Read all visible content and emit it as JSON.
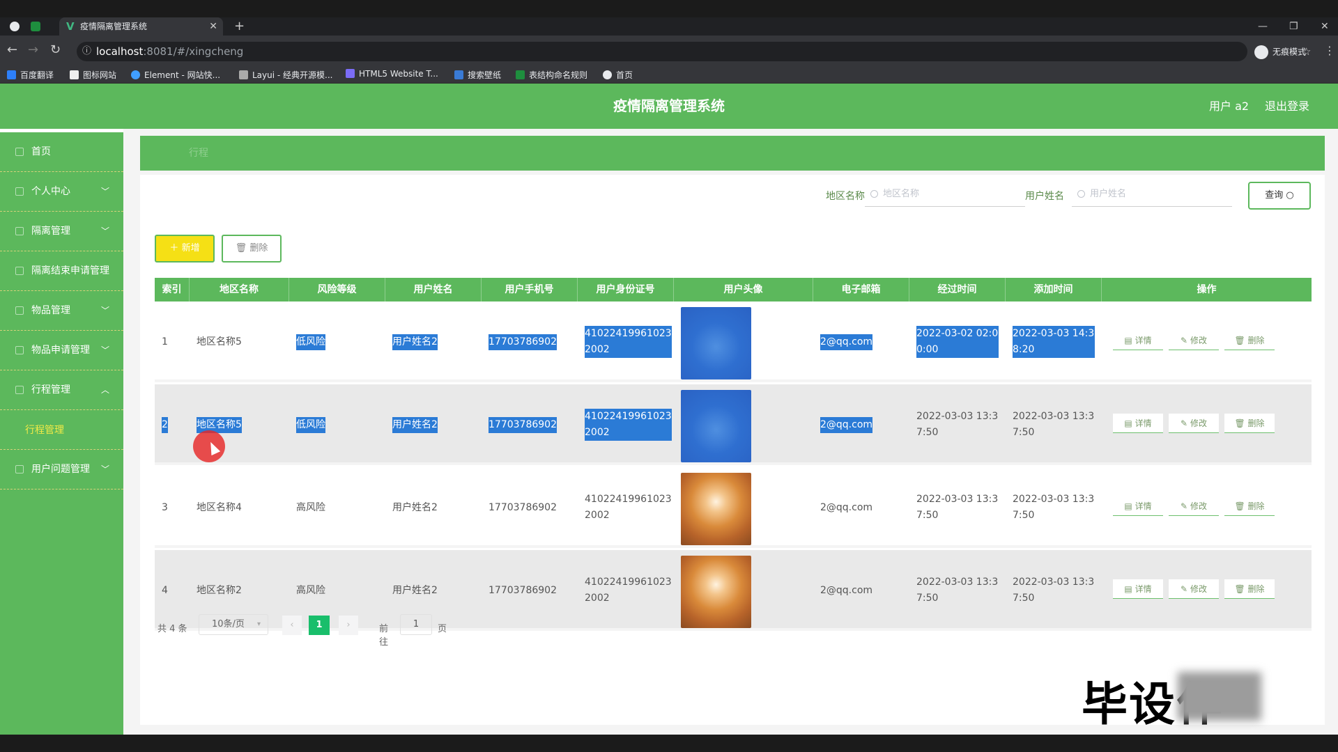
{
  "browser": {
    "tab_title": "疫情隔离管理系统",
    "url_host": "localhost",
    "url_path": ":8081/#/xingcheng",
    "incognito_label": "无痕模式",
    "bookmarks": [
      "百度翻译",
      "图标网站",
      "Element - 网站快...",
      "Layui - 经典开源模...",
      "HTML5 Website T...",
      "搜索壁纸",
      "表结构命名规则",
      "首页"
    ]
  },
  "app": {
    "title": "疫情隔离管理系统",
    "user": "用户 a2",
    "logout": "退出登录"
  },
  "sidebar": {
    "items": [
      {
        "label": "首页",
        "has_children": false
      },
      {
        "label": "个人中心",
        "has_children": true
      },
      {
        "label": "隔离管理",
        "has_children": true
      },
      {
        "label": "隔离结束申请管理",
        "has_children": false
      },
      {
        "label": "物品管理",
        "has_children": true
      },
      {
        "label": "物品申请管理",
        "has_children": true
      },
      {
        "label": "行程管理",
        "has_children": true,
        "expanded": true
      },
      {
        "label": "用户问题管理",
        "has_children": true
      }
    ],
    "submenu": {
      "label": "行程管理"
    }
  },
  "breadcrumb": {
    "label": "行程"
  },
  "search": {
    "region_label": "地区名称",
    "region_placeholder": "地区名称",
    "username_label": "用户姓名",
    "username_placeholder": "用户姓名",
    "query_button": "查询"
  },
  "toolbar": {
    "add_label": "新增",
    "delete_label": "删除"
  },
  "table": {
    "headers": [
      "索引",
      "地区名称",
      "风险等级",
      "用户姓名",
      "用户手机号",
      "用户身份证号",
      "用户头像",
      "电子邮箱",
      "经过时间",
      "添加时间",
      "操作"
    ],
    "rows": [
      {
        "index": "1",
        "region": "地区名称5",
        "risk": "低风险",
        "name": "用户姓名2",
        "phone": "17703786902",
        "id_card": "41022419961023 2002",
        "avatar": "blue",
        "email": "2@qq.com",
        "pass_time": "2022-03-02 02:0 0:00",
        "add_time": "2022-03-03 14:3 8:20"
      },
      {
        "index": "2",
        "region": "地区名称5",
        "risk": "低风险",
        "name": "用户姓名2",
        "phone": "17703786902",
        "id_card": "41022419961023 2002",
        "avatar": "blue",
        "email": "2@qq.com",
        "pass_time": "2022-03-03 13:3 7:50",
        "add_time": "2022-03-03 13:3 7:50"
      },
      {
        "index": "3",
        "region": "地区名称4",
        "risk": "高风险",
        "name": "用户姓名2",
        "phone": "17703786902",
        "id_card": "41022419961023 2002",
        "avatar": "dog",
        "email": "2@qq.com",
        "pass_time": "2022-03-03 13:3 7:50",
        "add_time": "2022-03-03 13:3 7:50"
      },
      {
        "index": "4",
        "region": "地区名称2",
        "risk": "高风险",
        "name": "用户姓名2",
        "phone": "17703786902",
        "id_card": "41022419961023 2002",
        "avatar": "dog",
        "email": "2@qq.com",
        "pass_time": "2022-03-03 13:3 7:50",
        "add_time": "2022-03-03 13:3 7:50"
      }
    ],
    "actions": {
      "detail": "详情",
      "edit": "修改",
      "delete": "删除"
    }
  },
  "pagination": {
    "total": "共 4 条",
    "page_size": "10条/页",
    "current_page": "1",
    "goto_label": "前往",
    "goto_value": "1",
    "goto_unit": "页"
  },
  "watermark": {
    "text": "毕设作"
  },
  "colors": {
    "primary": "#5cb85c",
    "highlight": "#2b7bd6",
    "add_button": "#f5e015"
  },
  "icons": {
    "search": "search-icon",
    "plus": "plus-icon",
    "trash": "trash-icon",
    "detail": "document-icon",
    "edit": "edit-icon"
  }
}
